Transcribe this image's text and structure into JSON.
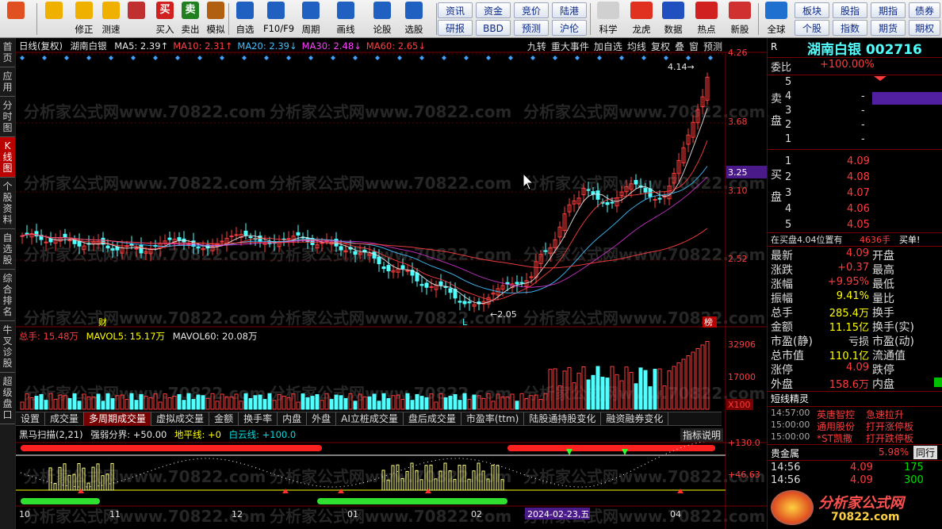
{
  "toolbar": {
    "buttons": [
      {
        "label": "",
        "icon": "app-grid-icon",
        "color": "#e05020"
      },
      {
        "label": "",
        "icon": "back-arrow-icon",
        "color": "#f0b000"
      },
      {
        "label": "修正",
        "icon": "up-down-icon",
        "color": "#f0b000"
      },
      {
        "label": "测速",
        "icon": "speed-icon",
        "color": "#f0b000"
      },
      {
        "label": "",
        "icon": "clock-icon",
        "color": "#c03030"
      },
      {
        "label": "买入",
        "icon": "buy-icon",
        "color": "#d02020",
        "glyph": "买"
      },
      {
        "label": "卖出",
        "icon": "sell-icon",
        "color": "#208020",
        "glyph": "卖"
      },
      {
        "label": "模拟",
        "icon": "hammer-icon",
        "color": "#b06010"
      },
      {
        "label": "自选",
        "icon": "star-icon",
        "color": "#2060c0"
      },
      {
        "label": "F10/F9",
        "icon": "f10-icon",
        "color": "#2060c0"
      },
      {
        "label": "周期",
        "icon": "period-icon",
        "color": "#2060c0"
      },
      {
        "label": "画线",
        "icon": "pen-icon",
        "color": "#2060c0"
      },
      {
        "label": "论股",
        "icon": "talk-icon",
        "color": "#2060c0"
      },
      {
        "label": "选股",
        "icon": "select-icon",
        "color": "#2060c0"
      }
    ],
    "mini_buttons": [
      "资讯",
      "资金",
      "竞价",
      "陆港",
      "研报",
      "BBD",
      "预测",
      "沪伦"
    ],
    "right_buttons": [
      {
        "label": "科学",
        "icon": "chart-icon"
      },
      {
        "label": "龙虎",
        "icon": "dragon-icon"
      },
      {
        "label": "数据",
        "icon": "pe-icon"
      },
      {
        "label": "热点",
        "icon": "hot-icon"
      },
      {
        "label": "新股",
        "icon": "new-stock-icon"
      },
      {
        "label": "全球",
        "icon": "globe-icon"
      }
    ],
    "far_right": [
      "板块",
      "股指",
      "期指",
      "债券",
      "个股",
      "指数",
      "期货",
      "期权"
    ]
  },
  "left_tabs": [
    "首页",
    "应用",
    "分时图",
    "K线图",
    "个股资料",
    "自选股",
    "综合排名",
    "牛叉诊股",
    "超级盘口"
  ],
  "chart": {
    "period": "日线(复权)",
    "stock_name": "湖南白银",
    "ma": [
      {
        "label": "MA5: 2.39",
        "color": "#e6e6e6",
        "arrow": "↑"
      },
      {
        "label": "MA10: 2.31",
        "color": "#ff4040",
        "arrow": "↑"
      },
      {
        "label": "MA20: 2.39",
        "color": "#40c0ff",
        "arrow": "↓"
      },
      {
        "label": "MA30: 2.48",
        "color": "#ff40ff",
        "arrow": "↓"
      },
      {
        "label": "MA60: 2.65",
        "color": "#ff4040",
        "arrow": "↓"
      }
    ],
    "tools": [
      "九转",
      "重大事件",
      "加自选",
      "均线",
      "复权",
      "叠",
      "窗",
      "预测"
    ],
    "price_ticks": [
      "4.26",
      "3.68",
      "3.25",
      "3.10",
      "2.52"
    ],
    "current_price_marker": "3.25",
    "high_label": "4.14",
    "low_label": "2.05",
    "markers": {
      "cai": "财",
      "L": "L",
      "bang": "榜"
    },
    "volume": {
      "label": "总手: 15.48万",
      "mavol5": "MAVOL5: 15.17万",
      "mavol60": "MAVOL60: 20.08万",
      "ticks": [
        "32906",
        "17000",
        "X100"
      ]
    },
    "ind_tabs": [
      "设置",
      "成交量",
      "多周期成交量",
      "虚拟成交量",
      "金额",
      "换手率",
      "内盘",
      "外盘",
      "AI立桩成交量",
      "盘后成交量",
      "市盈率(ttm)",
      "陆股通持股变化",
      "融资融券变化"
    ],
    "active_ind_tab": 2,
    "indicator": {
      "name": "黑马扫描(2,21)",
      "sep": "强弱分界: +50.00",
      "dpx": "地平线: +0",
      "byx": "白云线: +100.0",
      "help": "指标说明",
      "ticks": [
        "+130.0",
        "+46.63"
      ]
    },
    "date_axis": [
      "10",
      "11",
      "12",
      "01",
      "02",
      "04"
    ],
    "date_cursor": "2024-02-23,五",
    "watermark": "分析家公式网www.70822.com"
  },
  "chart_data": {
    "type": "candlestick",
    "title": "湖南白银",
    "ylim": [
      1.9,
      4.3
    ],
    "labels": {
      "high": 4.14,
      "low": 2.05
    }
  },
  "right": {
    "title": "湖南白银",
    "code": "002716",
    "r_label": "R",
    "weibi_label": "委比",
    "weibi_value": "+100.00%",
    "sell_label": "卖盘",
    "buy_label": "买盘",
    "sell": [
      {
        "n": "5",
        "p": "",
        "v": ""
      },
      {
        "n": "4",
        "p": "-",
        "v": ""
      },
      {
        "n": "3",
        "p": "-",
        "v": ""
      },
      {
        "n": "2",
        "p": "-",
        "v": ""
      },
      {
        "n": "1",
        "p": "-",
        "v": ""
      }
    ],
    "buy": [
      {
        "n": "1",
        "p": "4.09",
        "v": ""
      },
      {
        "n": "2",
        "p": "4.08",
        "v": ""
      },
      {
        "n": "3",
        "p": "4.07",
        "v": ""
      },
      {
        "n": "4",
        "p": "4.06",
        "v": ""
      },
      {
        "n": "5",
        "p": "4.05",
        "v": ""
      }
    ],
    "zaimaipan": "在买盘4.04位置有",
    "zaimaipan_vol": "4636手",
    "zaimaipan_tail": "买单!",
    "quote_left": [
      {
        "k": "最新",
        "v": "4.09",
        "c": "red"
      },
      {
        "k": "涨跌",
        "v": "+0.37",
        "c": "red"
      },
      {
        "k": "涨幅",
        "v": "+9.95%",
        "c": "red"
      },
      {
        "k": "振幅",
        "v": "9.41%",
        "c": "yellow"
      },
      {
        "k": "总手",
        "v": "285.4万",
        "c": "yellow"
      },
      {
        "k": "金额",
        "v": "11.15亿",
        "c": "yellow"
      },
      {
        "k": "市盈(静)",
        "v": "亏损",
        "c": "white"
      },
      {
        "k": "总市值",
        "v": "110.1亿",
        "c": "yellow"
      },
      {
        "k": "涨停",
        "v": "4.09",
        "c": "red"
      },
      {
        "k": "外盘",
        "v": "158.6万",
        "c": "red"
      }
    ],
    "quote_right": [
      "开盘",
      "最高",
      "最低",
      "量比",
      "换手",
      "换手(实)",
      "市盈(动)",
      "流通值",
      "跌停",
      "内盘"
    ],
    "jingling_title": "短线精灵",
    "jingling": [
      {
        "t": "14:57:00",
        "name": "英唐智控",
        "ev": "急速拉升"
      },
      {
        "t": "15:00:00",
        "name": "通用股份",
        "ev": "打开涨停板"
      },
      {
        "t": "15:00:00",
        "name": "*ST凯撒",
        "ev": "打开跌停板"
      }
    ],
    "sector": "贵金属",
    "sector_pct": "5.98%",
    "sector_tab": "同行",
    "ticks": [
      {
        "t": "14:56",
        "p": "4.09",
        "v": "175"
      },
      {
        "t": "14:56",
        "p": "4.09",
        "v": "300"
      }
    ],
    "logo": "分析家公式网",
    "logo_url": "70822.com"
  }
}
